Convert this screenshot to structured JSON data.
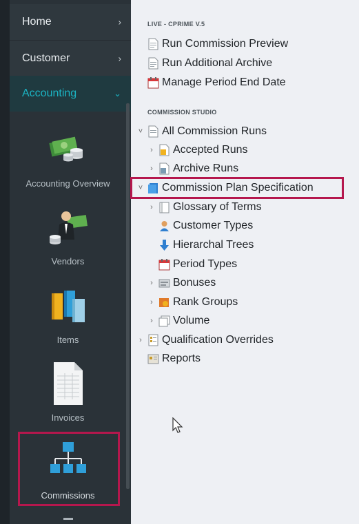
{
  "sidebar": {
    "nav": [
      {
        "label": "Home"
      },
      {
        "label": "Customer"
      },
      {
        "label": "Accounting"
      }
    ],
    "items": [
      {
        "label": "Accounting Overview",
        "icon": "money-stack-icon"
      },
      {
        "label": "Vendors",
        "icon": "vendor-person-icon"
      },
      {
        "label": "Items",
        "icon": "items-boxes-icon"
      },
      {
        "label": "Invoices",
        "icon": "invoice-document-icon"
      },
      {
        "label": "Commissions",
        "icon": "org-chart-icon"
      }
    ]
  },
  "main": {
    "live_section": {
      "title": "LIVE - CPRIME V.5",
      "items": [
        {
          "label": "Run Commission Preview",
          "icon": "document-icon"
        },
        {
          "label": "Run Additional Archive",
          "icon": "document-icon"
        },
        {
          "label": "Manage Period End Date",
          "icon": "calendar-icon"
        }
      ]
    },
    "studio_section": {
      "title": "COMMISSION STUDIO",
      "tree": [
        {
          "label": "All Commission Runs",
          "icon": "document-icon",
          "arrow": "˅"
        },
        {
          "label": "Accepted Runs",
          "icon": "document-icon",
          "arrow": "›"
        },
        {
          "label": "Archive Runs",
          "icon": "document-icon",
          "arrow": "›"
        },
        {
          "label": "Commission Plan Specification",
          "icon": "plan-book-icon",
          "arrow": "˅"
        },
        {
          "label": "Glossary of Terms",
          "icon": "book-icon",
          "arrow": "›"
        },
        {
          "label": "Customer Types",
          "icon": "person-icon",
          "arrow": ""
        },
        {
          "label": "Hierarchal Trees",
          "icon": "down-arrow-icon",
          "arrow": ""
        },
        {
          "label": "Period Types",
          "icon": "calendar-icon",
          "arrow": ""
        },
        {
          "label": "Bonuses",
          "icon": "bonus-icon",
          "arrow": "›"
        },
        {
          "label": "Rank Groups",
          "icon": "rank-icon",
          "arrow": "›"
        },
        {
          "label": "Volume",
          "icon": "volume-icon",
          "arrow": "›"
        },
        {
          "label": "Qualification Overrides",
          "icon": "checklist-icon",
          "arrow": "›"
        },
        {
          "label": "Reports",
          "icon": "reports-icon",
          "arrow": ""
        }
      ]
    }
  },
  "colors": {
    "sidebar_bg": "#2a3238",
    "accent": "#1bb5c4",
    "highlight": "#b5174d",
    "main_bg": "#eef0f4"
  }
}
